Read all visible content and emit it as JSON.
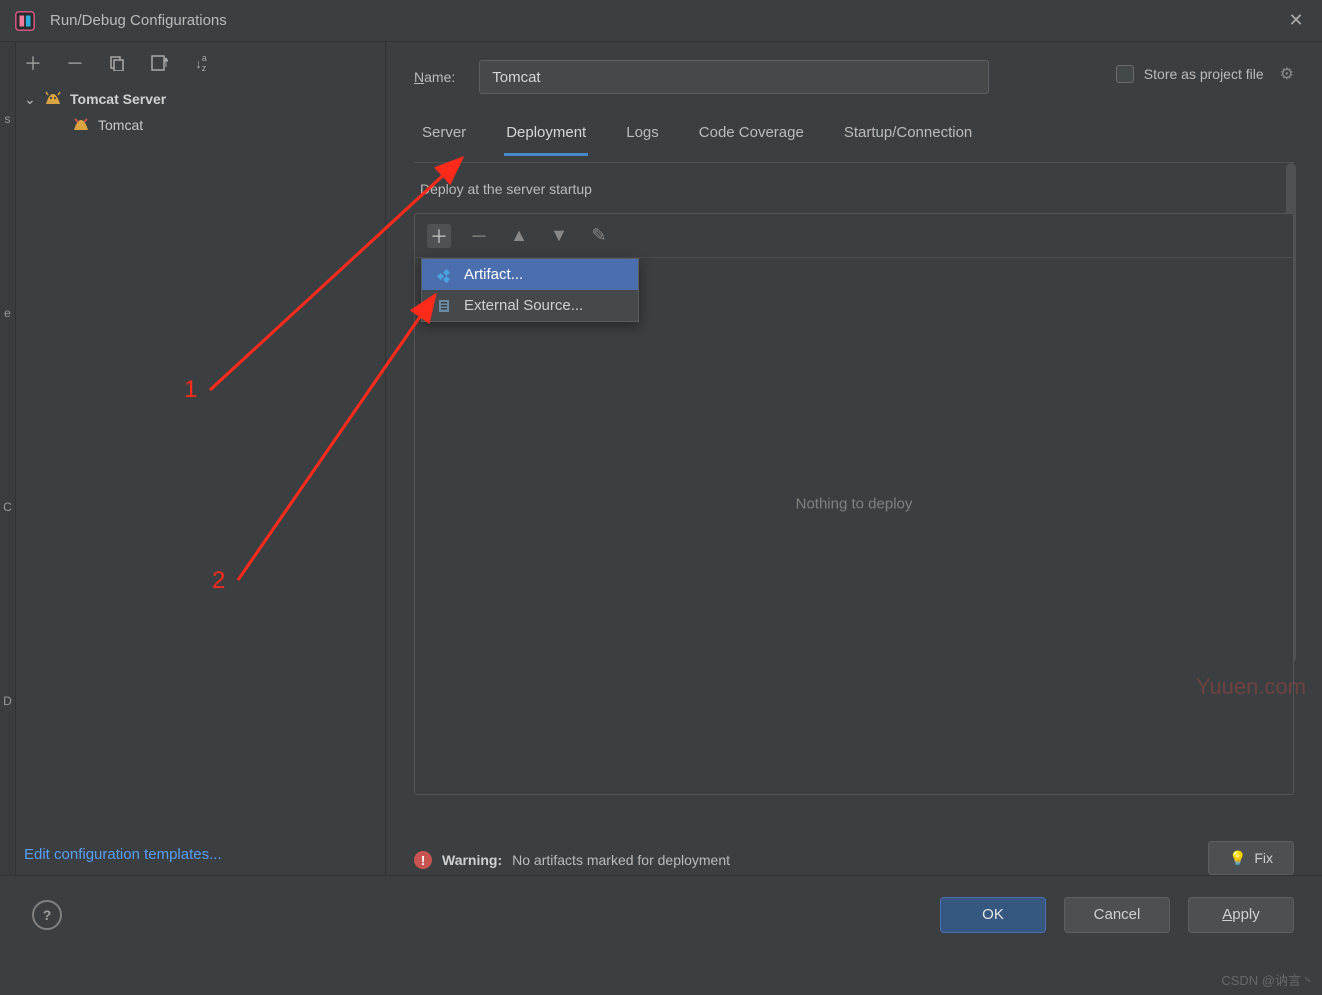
{
  "titlebar": {
    "title": "Run/Debug Configurations"
  },
  "leftGutter": [
    "s",
    "e",
    "C",
    "D"
  ],
  "leftToolbar": {
    "add": "＋",
    "remove": "－",
    "copy": "⧉",
    "save": "🖬",
    "sort": "↓ª"
  },
  "tree": {
    "groupLabel": "Tomcat Server",
    "childLabel": "Tomcat"
  },
  "editTemplates": "Edit configuration templates...",
  "nameRow": {
    "label": "Name:",
    "value": "Tomcat"
  },
  "storeRow": {
    "label": "Store as project file"
  },
  "tabs": [
    {
      "label": "Server",
      "active": false
    },
    {
      "label": "Deployment",
      "active": true
    },
    {
      "label": "Logs",
      "active": false
    },
    {
      "label": "Code Coverage",
      "active": false
    },
    {
      "label": "Startup/Connection",
      "active": false
    }
  ],
  "deploy": {
    "sectionLabel": "Deploy at the server startup",
    "emptyText": "Nothing to deploy",
    "popup": [
      {
        "label": "Artifact...",
        "selected": true
      },
      {
        "label": "External Source...",
        "selected": false
      }
    ]
  },
  "warning": {
    "label": "Warning:",
    "text": "No artifacts marked for deployment",
    "fix": "Fix"
  },
  "footer": {
    "ok": "OK",
    "cancel": "Cancel",
    "apply": "Apply"
  },
  "annotations": {
    "one": "1",
    "two": "2"
  },
  "watermarks": {
    "tl": "Yuuen.com",
    "br": "CSDN @讷言丶"
  }
}
